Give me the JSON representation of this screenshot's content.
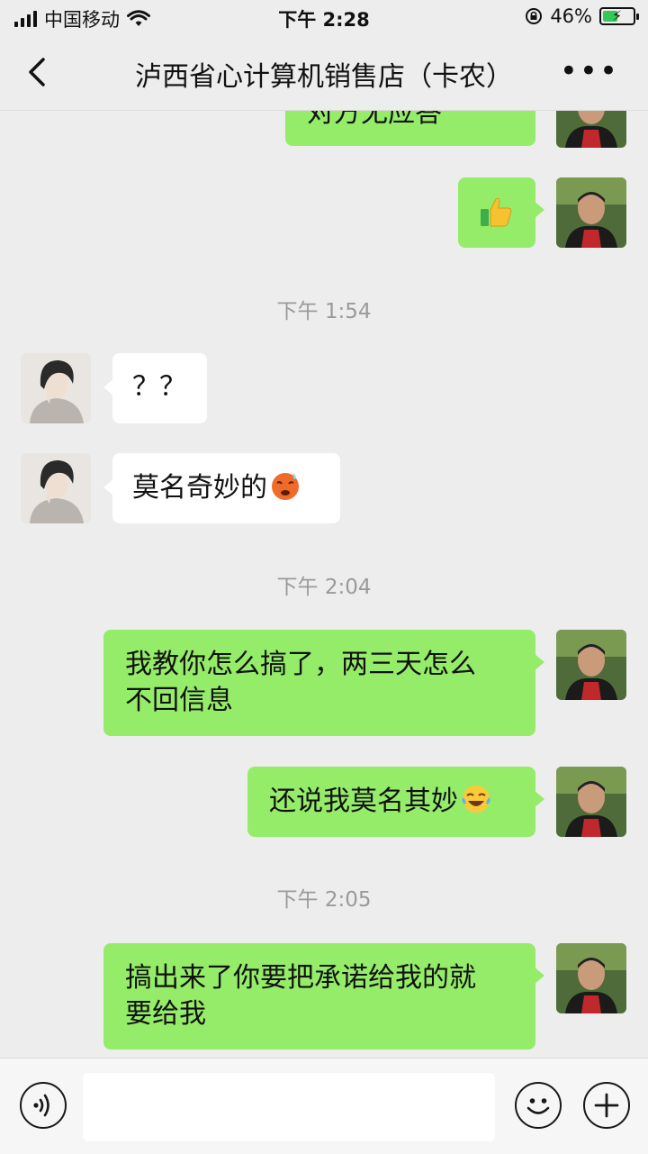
{
  "status_bar": {
    "carrier": "中国移动",
    "time": "下午 2:28",
    "battery_percent": "46%",
    "battery_level": 0.46,
    "icons": [
      "signal-icon",
      "wifi-icon",
      "orientation-lock-icon",
      "battery-charging-icon"
    ]
  },
  "nav": {
    "title": "泸西省心计算机销售店（卡农）",
    "back_icon": "chevron-left-icon",
    "more_icon": "more-icon"
  },
  "messages": [
    {
      "type": "sent",
      "text": "对方无应答",
      "partial": true
    },
    {
      "type": "sent",
      "emoji": "thumbs-up-icon"
    },
    {
      "type": "time",
      "text": "下午 1:54"
    },
    {
      "type": "received",
      "text": "？？"
    },
    {
      "type": "received",
      "text": "莫名奇妙的",
      "emoji": "tired-face-icon"
    },
    {
      "type": "time",
      "text": "下午 2:04"
    },
    {
      "type": "sent",
      "lines": [
        "我教你怎么搞了，两三天怎么",
        "不回信息"
      ]
    },
    {
      "type": "sent",
      "text": "还说我莫名其妙",
      "emoji": "crying-laugh-icon"
    },
    {
      "type": "time",
      "text": "下午 2:05"
    },
    {
      "type": "sent",
      "lines": [
        "搞出来了你要把承诺给我的就",
        "要给我"
      ]
    }
  ],
  "input_bar": {
    "voice_icon": "voice-icon",
    "emoji_icon": "smile-icon",
    "plus_icon": "plus-icon",
    "text_value": ""
  },
  "colors": {
    "background": "#ededed",
    "sent_bubble": "#95ec69",
    "received_bubble": "#ffffff",
    "timestamp_text": "#9a9a9a"
  }
}
